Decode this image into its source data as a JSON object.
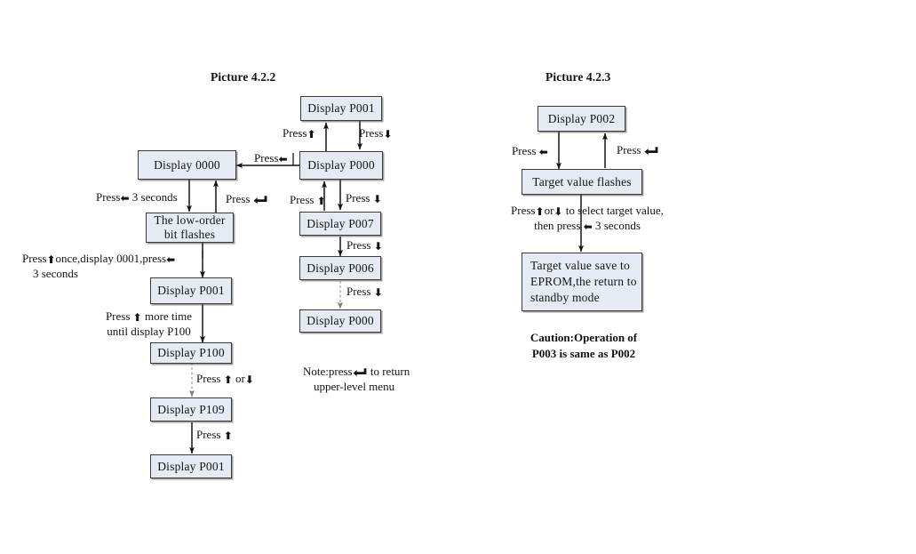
{
  "diagrams": [
    {
      "id": "picture-422",
      "title": "Picture 4.2.2",
      "nodes": [
        {
          "id": "p001-top",
          "text": "Display P001"
        },
        {
          "id": "p000-main",
          "text": "Display P000"
        },
        {
          "id": "d0000",
          "text": "Display 0000"
        },
        {
          "id": "low-order-bit",
          "text": "The low-order\nbit flashes"
        },
        {
          "id": "p001-mid",
          "text": "Display P001"
        },
        {
          "id": "p100",
          "text": "Display P100"
        },
        {
          "id": "p109",
          "text": "Display P109"
        },
        {
          "id": "p001-bottom",
          "text": "Display P001"
        },
        {
          "id": "p007",
          "text": "Display P007"
        },
        {
          "id": "p006",
          "text": "Display P006"
        },
        {
          "id": "p000-bottom",
          "text": "Display P000"
        }
      ],
      "labels": {
        "press_up_to_p001": "Press",
        "press_down_to_p001": "Press",
        "press_left_to_0000": "Press",
        "press_left_3_seconds": "Press",
        "press_left_3_seconds_b": "3 seconds",
        "press_return_to_0000": "Press",
        "press_up_once_line1_a": "Press",
        "press_up_once_line1_b": "once,display 0001,press",
        "press_up_once_line2": "3 seconds",
        "press_more_time_line1_a": "Press",
        "press_more_time_line1_b": "more time",
        "press_more_time_line2": "until display P100",
        "press_up_or_down_a": "Press",
        "press_up_or_down_b": "or",
        "press_up_p109": "Press",
        "press_up_p007": "Press",
        "press_down_p007": "Press",
        "press_down_p006": "Press",
        "press_down_p000": "Press",
        "note_line1_a": "Note:press",
        "note_line1_b": "to return",
        "note_line2": "upper-level menu"
      }
    },
    {
      "id": "picture-423",
      "title": "Picture 4.2.3",
      "nodes": [
        {
          "id": "p002",
          "text": "Display P002"
        },
        {
          "id": "target-value-flash",
          "text": "Target value flashes"
        },
        {
          "id": "target-value-save",
          "text": "Target value save to\nEPROM,the return to\nstandby mode"
        }
      ],
      "labels": {
        "press_left_down": "Press",
        "press_return_up": "Press",
        "select_line1_a": "Press",
        "select_line1_b": "or",
        "select_line1_c": "to select target value,",
        "select_line2_a": "then press",
        "select_line2_b": "3 seconds"
      },
      "caution": {
        "line1": "Caution:Operation  of",
        "line2": "P003 is same as P002"
      }
    }
  ],
  "icons": {
    "up_arrow": "arrow-up-icon",
    "down_arrow": "arrow-down-icon",
    "left_arrow": "arrow-left-icon",
    "return_key": "return-key-icon"
  },
  "colors": {
    "node_fill": "#e6eaf2",
    "node_border": "#3a3a3a",
    "text": "#141414",
    "background": "#ffffff",
    "edge": "#1a1a1a"
  }
}
